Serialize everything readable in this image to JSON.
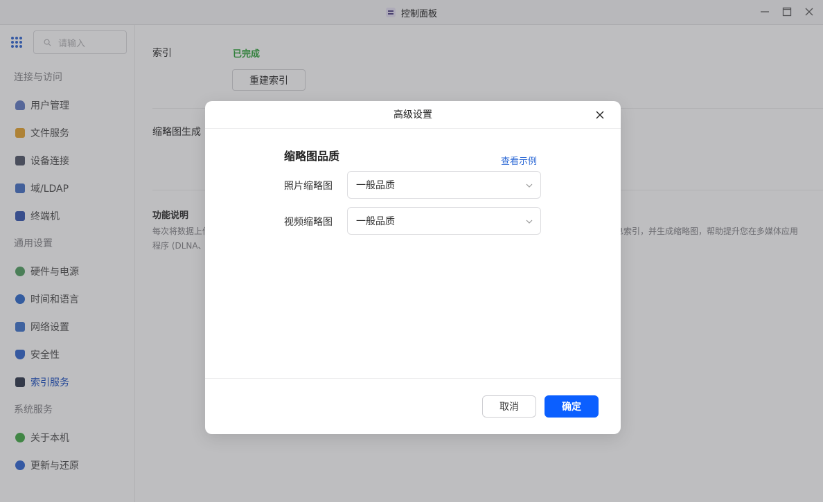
{
  "window": {
    "title": "控制面板"
  },
  "sidebar": {
    "search_placeholder": "请输入",
    "groups": [
      {
        "label": "连接与访问",
        "items": [
          {
            "label": "用户管理",
            "icon": "user-icon",
            "color": "#6b83c8"
          },
          {
            "label": "文件服务",
            "icon": "folder-icon",
            "color": "#e9a93a"
          },
          {
            "label": "设备连接",
            "icon": "device-icon",
            "color": "#5a5f70"
          },
          {
            "label": "域/LDAP",
            "icon": "domain-icon",
            "color": "#4f79c9"
          },
          {
            "label": "终端机",
            "icon": "terminal-icon",
            "color": "#3f5fb5"
          }
        ]
      },
      {
        "label": "通用设置",
        "items": [
          {
            "label": "硬件与电源",
            "icon": "power-icon",
            "color": "#5ba56a"
          },
          {
            "label": "时间和语言",
            "icon": "globe-icon",
            "color": "#3a73d0"
          },
          {
            "label": "网络设置",
            "icon": "network-icon",
            "color": "#4a7bd0"
          },
          {
            "label": "安全性",
            "icon": "shield-icon",
            "color": "#3d6fd1"
          },
          {
            "label": "索引服务",
            "icon": "index-icon",
            "color": "#3a4355",
            "active": true
          }
        ]
      },
      {
        "label": "系统服务",
        "items": [
          {
            "label": "关于本机",
            "icon": "info-icon",
            "color": "#4caf50"
          },
          {
            "label": "更新与还原",
            "icon": "update-icon",
            "color": "#3b6fd6"
          }
        ]
      }
    ]
  },
  "main": {
    "index_label": "索引",
    "index_status": "已完成",
    "rebuild_label": "重建索引",
    "thumb_gen_label": "缩略图生成",
    "func_title": "功能说明",
    "func_text_line1_left": "每次将数据上传",
    "func_text_line1_right": "息索引，并生成缩略图，帮助提升您在多媒体应用",
    "func_text_line2_left": "程序 (DLNA、"
  },
  "modal": {
    "title": "高级设置",
    "section_title": "缩略图品质",
    "example_link": "查看示例",
    "photo_label": "照片缩略图",
    "photo_value": "一般品质",
    "video_label": "视频缩略图",
    "video_value": "一般品质",
    "cancel_label": "取消",
    "ok_label": "确定"
  }
}
